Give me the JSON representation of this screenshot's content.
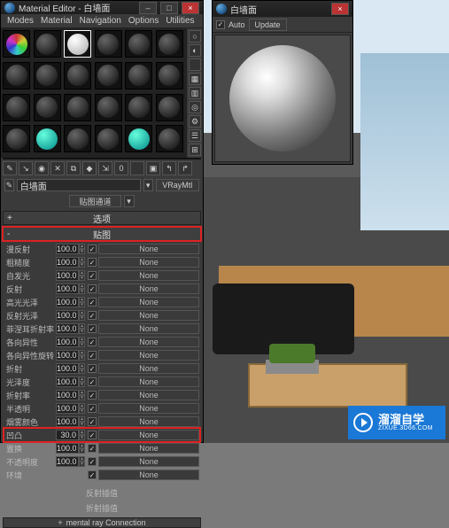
{
  "editor": {
    "title": "Material Editor - 白墙面",
    "menus": [
      "Modes",
      "Material",
      "Navigation",
      "Options",
      "Utilities"
    ],
    "material_name": "白墙面",
    "material_type": "VRayMtl",
    "dropdown_channel": "贴图通道",
    "sections": {
      "options": "选项",
      "maps": "贴图"
    },
    "map_rows": [
      {
        "label": "漫反射",
        "value": "100.0",
        "checked": true,
        "slot": "None"
      },
      {
        "label": "粗糙度",
        "value": "100.0",
        "checked": true,
        "slot": "None"
      },
      {
        "label": "自发光",
        "value": "100.0",
        "checked": true,
        "slot": "None"
      },
      {
        "label": "反射",
        "value": "100.0",
        "checked": true,
        "slot": "None"
      },
      {
        "label": "高光光泽",
        "value": "100.0",
        "checked": true,
        "slot": "None"
      },
      {
        "label": "反射光泽",
        "value": "100.0",
        "checked": true,
        "slot": "None"
      },
      {
        "label": "菲涅耳折射率",
        "value": "100.0",
        "checked": true,
        "slot": "None"
      },
      {
        "label": "各向异性",
        "value": "100.0",
        "checked": true,
        "slot": "None"
      },
      {
        "label": "各向异性旋转",
        "value": "100.0",
        "checked": true,
        "slot": "None"
      },
      {
        "label": "折射",
        "value": "100.0",
        "checked": true,
        "slot": "None"
      },
      {
        "label": "光泽度",
        "value": "100.0",
        "checked": true,
        "slot": "None"
      },
      {
        "label": "折射率",
        "value": "100.0",
        "checked": true,
        "slot": "None"
      },
      {
        "label": "半透明",
        "value": "100.0",
        "checked": true,
        "slot": "None"
      },
      {
        "label": "烟雾颜色",
        "value": "100.0",
        "checked": true,
        "slot": "None"
      },
      {
        "label": "凹凸",
        "value": "30.0",
        "checked": true,
        "slot": "None",
        "hl": true
      },
      {
        "label": "置换",
        "value": "100.0",
        "checked": true,
        "slot": "None"
      },
      {
        "label": "不透明度",
        "value": "100.0",
        "checked": true,
        "slot": "None"
      },
      {
        "label": "环境",
        "value": "",
        "checked": true,
        "slot": "None"
      }
    ],
    "refl_interp": "反射插值",
    "refr_interp": "折射插值",
    "mental_ray": "mental ray Connection"
  },
  "preview": {
    "title": "白墙面",
    "auto_label": "Auto",
    "update_label": "Update"
  },
  "watermark": {
    "brand": "溜溜自学",
    "url": "ZIXUE.3D66.COM"
  },
  "swatches": [
    "colors",
    "dark",
    "white",
    "dark",
    "dark",
    "dark",
    "dark",
    "dark",
    "dark",
    "dark",
    "dark",
    "dark",
    "dark",
    "dark",
    "dark",
    "dark",
    "dark",
    "dark",
    "dark",
    "teal",
    "dark",
    "dark",
    "teal",
    "dark"
  ]
}
